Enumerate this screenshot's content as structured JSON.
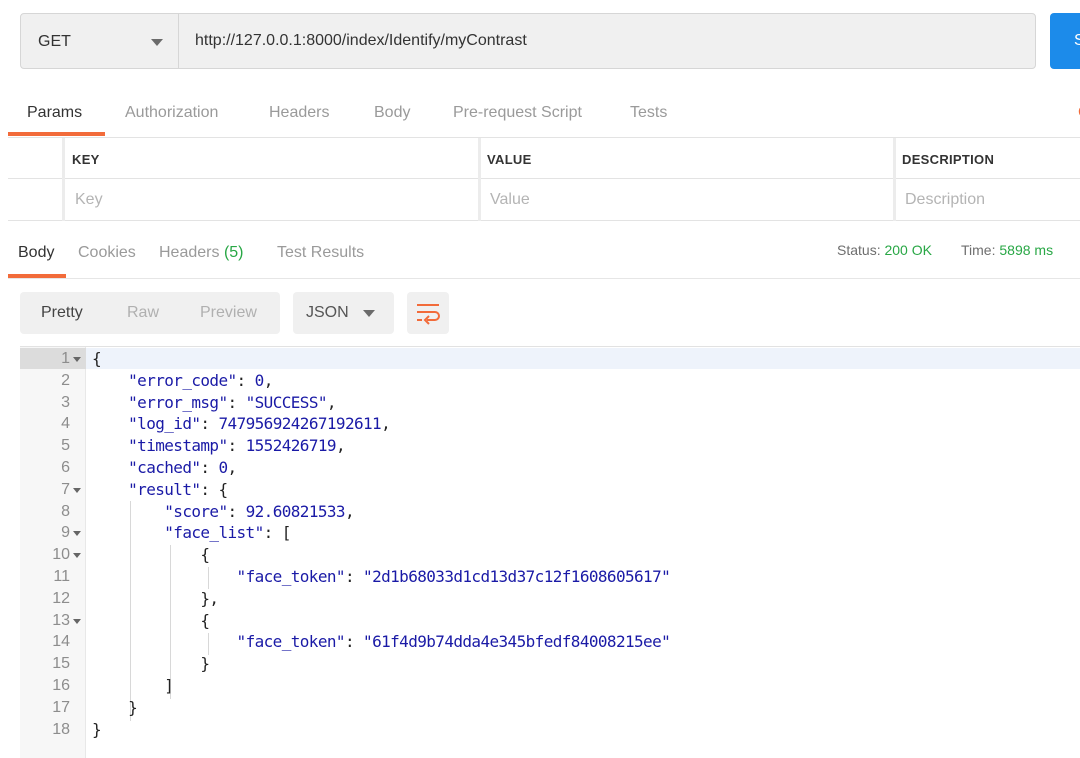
{
  "request": {
    "method": "GET",
    "url": "http://127.0.0.1:8000/index/Identify/myContrast",
    "send_label": "S"
  },
  "request_tabs": [
    "Params",
    "Authorization",
    "Headers",
    "Body",
    "Pre-request Script",
    "Tests"
  ],
  "request_tabs_right": "C",
  "params": {
    "headers": [
      "KEY",
      "VALUE",
      "DESCRIPTION"
    ],
    "placeholders": {
      "key": "Key",
      "value": "Value",
      "description": "Description"
    }
  },
  "response_tabs": {
    "body": "Body",
    "cookies": "Cookies",
    "headers": "Headers",
    "headers_count": "(5)",
    "test_results": "Test Results"
  },
  "status": {
    "status_label": "Status:",
    "status_value": "200 OK",
    "time_label": "Time:",
    "time_value": "5898 ms"
  },
  "view_modes": [
    "Pretty",
    "Raw",
    "Preview"
  ],
  "format": "JSON",
  "colors": {
    "accent": "#f26b3a",
    "send_button": "#1c8bea",
    "status_green": "#28a745",
    "json_value": "#1a1aa6"
  },
  "code_lines": [
    {
      "n": "1",
      "fold": true,
      "code": "{"
    },
    {
      "n": "2",
      "fold": false,
      "code": "    \"error_code\": 0,"
    },
    {
      "n": "3",
      "fold": false,
      "code": "    \"error_msg\": \"SUCCESS\","
    },
    {
      "n": "4",
      "fold": false,
      "code": "    \"log_id\": 747956924267192611,"
    },
    {
      "n": "5",
      "fold": false,
      "code": "    \"timestamp\": 1552426719,"
    },
    {
      "n": "6",
      "fold": false,
      "code": "    \"cached\": 0,"
    },
    {
      "n": "7",
      "fold": true,
      "code": "    \"result\": {"
    },
    {
      "n": "8",
      "fold": false,
      "code": "        \"score\": 92.60821533,"
    },
    {
      "n": "9",
      "fold": true,
      "code": "        \"face_list\": ["
    },
    {
      "n": "10",
      "fold": true,
      "code": "            {"
    },
    {
      "n": "11",
      "fold": false,
      "code": "                \"face_token\": \"2d1b68033d1cd13d37c12f1608605617\""
    },
    {
      "n": "12",
      "fold": false,
      "code": "            },"
    },
    {
      "n": "13",
      "fold": true,
      "code": "            {"
    },
    {
      "n": "14",
      "fold": false,
      "code": "                \"face_token\": \"61f4d9b74dda4e345bfedf84008215ee\""
    },
    {
      "n": "15",
      "fold": false,
      "code": "            }"
    },
    {
      "n": "16",
      "fold": false,
      "code": "        ]"
    },
    {
      "n": "17",
      "fold": false,
      "code": "    }"
    },
    {
      "n": "18",
      "fold": false,
      "code": "}"
    }
  ]
}
